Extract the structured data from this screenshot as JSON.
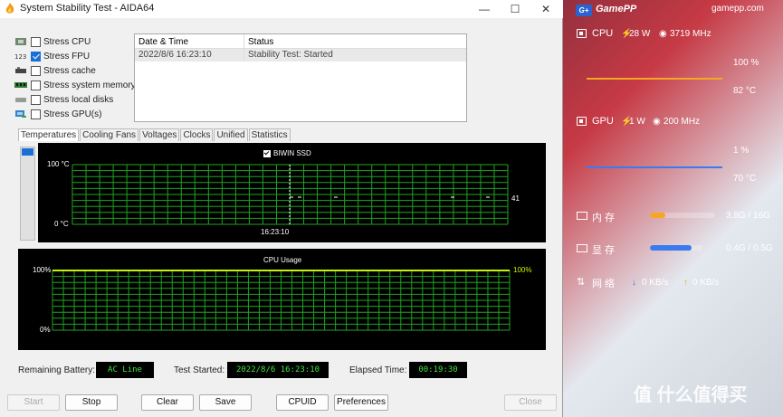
{
  "window": {
    "title": "System Stability Test - AIDA64",
    "minimize": "—",
    "maximize": "☐",
    "close": "✕"
  },
  "stress": [
    {
      "label": "Stress CPU",
      "checked": false,
      "icon": "cpu-chip-icon"
    },
    {
      "label": "Stress FPU",
      "checked": true,
      "icon": "fpu-icon"
    },
    {
      "label": "Stress cache",
      "checked": false,
      "icon": "cache-icon"
    },
    {
      "label": "Stress system memory",
      "checked": false,
      "icon": "memory-module-icon"
    },
    {
      "label": "Stress local disks",
      "checked": false,
      "icon": "disk-icon"
    },
    {
      "label": "Stress GPU(s)",
      "checked": false,
      "icon": "gpu-icon"
    }
  ],
  "log": {
    "headers": [
      "Date & Time",
      "Status"
    ],
    "rows": [
      [
        "2022/8/6 16:23:10",
        "Stability Test: Started"
      ]
    ]
  },
  "tabs": [
    "Temperatures",
    "Cooling Fans",
    "Voltages",
    "Clocks",
    "Unified",
    "Statistics"
  ],
  "temp_chart": {
    "y_top": "100 °C",
    "y_bottom": "0 °C",
    "legend": "BIWIN SSD",
    "time_label": "16:23:10",
    "current_value": "41"
  },
  "usage_chart": {
    "title": "CPU Usage",
    "y_top": "100%",
    "y_bottom": "0%",
    "current_value": "100%"
  },
  "status": {
    "battery_label": "Remaining Battery:",
    "battery_value": "AC Line",
    "started_label": "Test Started:",
    "started_value": "2022/8/6 16:23:10",
    "elapsed_label": "Elapsed Time:",
    "elapsed_value": "00:19:30"
  },
  "buttons": {
    "start": "Start",
    "stop": "Stop",
    "clear": "Clear",
    "save": "Save",
    "cpuid": "CPUID",
    "preferences": "Preferences",
    "close": "Close"
  },
  "gamepp": {
    "logo": "GamePP",
    "logo_badge": "G+",
    "url": "gamepp.com",
    "cpu": {
      "label": "CPU",
      "power": "28 W",
      "clock": "3719 MHz",
      "usage": "100 %",
      "temp": "82 °C"
    },
    "gpu": {
      "label": "GPU",
      "power": "1 W",
      "clock": "200 MHz",
      "usage": "1 %",
      "temp": "70 °C"
    },
    "memory": {
      "label": "内 存",
      "value": "3.8G / 16G",
      "fraction": 0.24
    },
    "vram": {
      "label": "显 存",
      "value": "0.4G / 0.5G",
      "fraction": 0.8
    },
    "network": {
      "label": "网 络",
      "down": "0 KB/s",
      "up": "0 KB/s"
    }
  },
  "watermark": "值 什么值得买",
  "colors": {
    "accent": "#1a6fd6",
    "chart_green": "#1fa31f",
    "status_green": "#3ee63e",
    "gp_orange": "#f5a623",
    "gp_blue": "#3a7bf0"
  }
}
